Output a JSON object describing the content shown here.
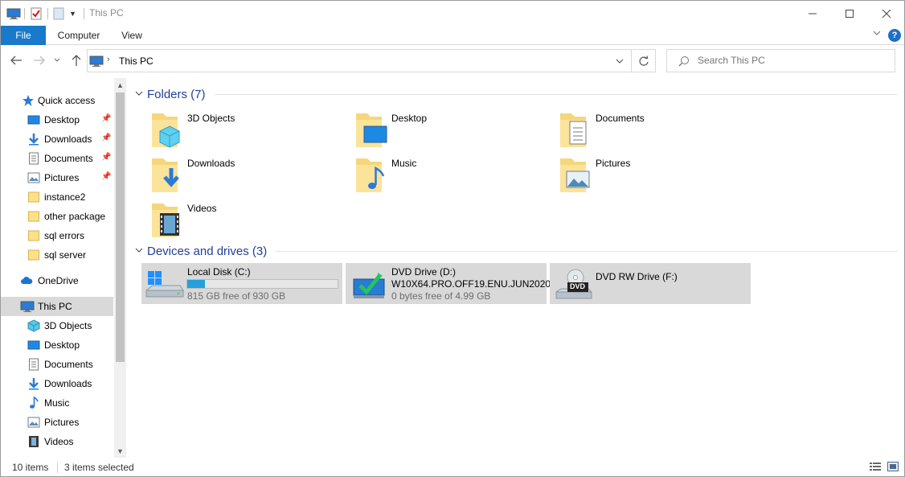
{
  "window": {
    "title": "This PC"
  },
  "ribbon": {
    "tabs": [
      "File",
      "Computer",
      "View"
    ],
    "help": "?"
  },
  "address": {
    "path": "This PC"
  },
  "search": {
    "placeholder": "Search This PC"
  },
  "nav": {
    "items": [
      {
        "label": "Quick access",
        "icon": "star-icon",
        "pinned": false
      },
      {
        "label": "Desktop",
        "icon": "desktop-icon",
        "pinned": true
      },
      {
        "label": "Downloads",
        "icon": "download-icon",
        "pinned": true
      },
      {
        "label": "Documents",
        "icon": "document-icon",
        "pinned": true
      },
      {
        "label": "Pictures",
        "icon": "picture-icon",
        "pinned": true
      },
      {
        "label": "instance2",
        "icon": "folder-icon",
        "pinned": false
      },
      {
        "label": "other package",
        "icon": "folder-icon",
        "pinned": false
      },
      {
        "label": "sql errors",
        "icon": "folder-icon",
        "pinned": false
      },
      {
        "label": "sql server",
        "icon": "folder-icon",
        "pinned": false
      },
      {
        "label": "OneDrive",
        "icon": "cloud-icon",
        "pinned": false
      },
      {
        "label": "This PC",
        "icon": "computer-icon",
        "pinned": false,
        "selected": true
      },
      {
        "label": "3D Objects",
        "icon": "cube-icon",
        "pinned": false
      },
      {
        "label": "Desktop",
        "icon": "desktop-icon",
        "pinned": false
      },
      {
        "label": "Documents",
        "icon": "document-icon",
        "pinned": false
      },
      {
        "label": "Downloads",
        "icon": "download-icon",
        "pinned": false
      },
      {
        "label": "Music",
        "icon": "music-icon",
        "pinned": false
      },
      {
        "label": "Pictures",
        "icon": "picture-icon",
        "pinned": false
      },
      {
        "label": "Videos",
        "icon": "video-icon",
        "pinned": false
      }
    ]
  },
  "folders": {
    "header": "Folders (7)",
    "items": [
      {
        "label": "3D Objects",
        "icon": "cube-icon"
      },
      {
        "label": "Desktop",
        "icon": "desktop-icon"
      },
      {
        "label": "Documents",
        "icon": "document-icon"
      },
      {
        "label": "Downloads",
        "icon": "download-icon"
      },
      {
        "label": "Music",
        "icon": "music-icon"
      },
      {
        "label": "Pictures",
        "icon": "picture-icon"
      },
      {
        "label": "Videos",
        "icon": "video-icon"
      }
    ]
  },
  "drives": {
    "header": "Devices and drives (3)",
    "items": [
      {
        "name": "Local Disk (C:)",
        "free": "815 GB free of 930 GB",
        "used_fraction": 0.12,
        "icon": "hard-drive-icon"
      },
      {
        "name": "DVD Drive (D:)",
        "line2": "W10X64.PRO.OFF19.ENU.JUN2020",
        "free": "0 bytes free of 4.99 GB",
        "icon": "dvd-drive-icon"
      },
      {
        "name": "DVD RW Drive (F:)",
        "icon": "dvd-rw-drive-icon",
        "badge": "DVD"
      }
    ]
  },
  "status": {
    "count": "10 items",
    "selected": "3 items selected"
  },
  "colors": {
    "accent": "#1979ca",
    "selection": "#d9d9d9",
    "group_title": "#1f3f99",
    "progress": "#26a0da"
  }
}
